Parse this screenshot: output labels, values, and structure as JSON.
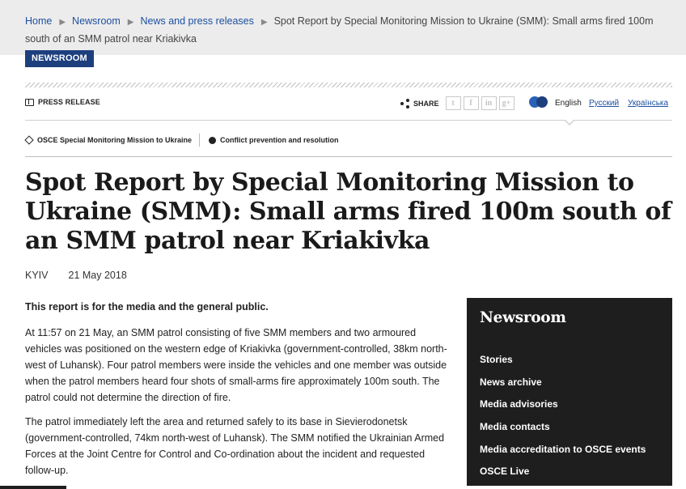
{
  "breadcrumb": {
    "items": [
      "Home",
      "Newsroom",
      "News and press releases"
    ],
    "current": "Spot Report by Special Monitoring Mission to Ukraine (SMM): Small arms fired 100m south of an SMM patrol near Kriakivka"
  },
  "section_tag": "NEWSROOM",
  "press_release_label": "PRESS RELEASE",
  "share": {
    "label": "SHARE",
    "networks": [
      {
        "icon": "twitter-icon",
        "glyph": "t"
      },
      {
        "icon": "facebook-icon",
        "glyph": "f"
      },
      {
        "icon": "linkedin-icon",
        "glyph": "in"
      },
      {
        "icon": "google-plus-icon",
        "glyph": "g+"
      }
    ]
  },
  "languages": {
    "current": "English",
    "others": [
      "Русский",
      "Українська"
    ]
  },
  "topics": [
    {
      "label": "OSCE Special Monitoring Mission to Ukraine",
      "icon": "diamond-icon"
    },
    {
      "label": "Conflict prevention and resolution",
      "icon": "cog-icon"
    }
  ],
  "article": {
    "title": "Spot Report by Special Monitoring Mission to Ukraine (SMM): Small arms fired 100m south of an SMM patrol near Kriakivka",
    "location": "KYIV",
    "date": "21 May 2018",
    "lead": "This report is for the media and the general public.",
    "paragraphs": [
      "At 11:57 on 21 May, an SMM patrol consisting of five SMM members and two armoured vehicles was positioned on the western edge of Kriakivka (government-controlled, 38km north-west of Luhansk). Four patrol members were inside the vehicles and one member was outside when the patrol members heard four shots of small-arms fire approximately 100m south. The patrol could not determine the direction of fire.",
      "The patrol immediately left the area and returned safely to its base in Sievierodonetsk (government-controlled, 74km north-west of Luhansk). The SMM notified the Ukrainian Armed Forces at the Joint Centre for Control and Co-ordination about the incident and requested follow-up."
    ]
  },
  "sidebar": {
    "title": "Newsroom",
    "links": [
      "Stories",
      "News archive",
      "Media advisories",
      "Media contacts",
      "Media accreditation to OSCE events",
      "OSCE Live"
    ]
  },
  "colors": {
    "link": "#1d4fa0",
    "tag_background": "#1d3f7e",
    "sidebar_background": "#1e1e1e",
    "breadcrumb_background": "#ececec"
  }
}
